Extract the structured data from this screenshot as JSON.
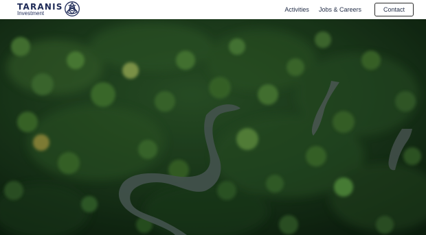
{
  "header": {
    "brand_name": "TARANIS",
    "brand_sub": "Investment",
    "brand_color": "#1e2a57"
  },
  "nav": {
    "items": [
      {
        "label": "Activities"
      },
      {
        "label": "Jobs & Careers"
      }
    ],
    "contact_label": "Contact"
  },
  "hero": {
    "image": "aerial-rainforest-river"
  }
}
